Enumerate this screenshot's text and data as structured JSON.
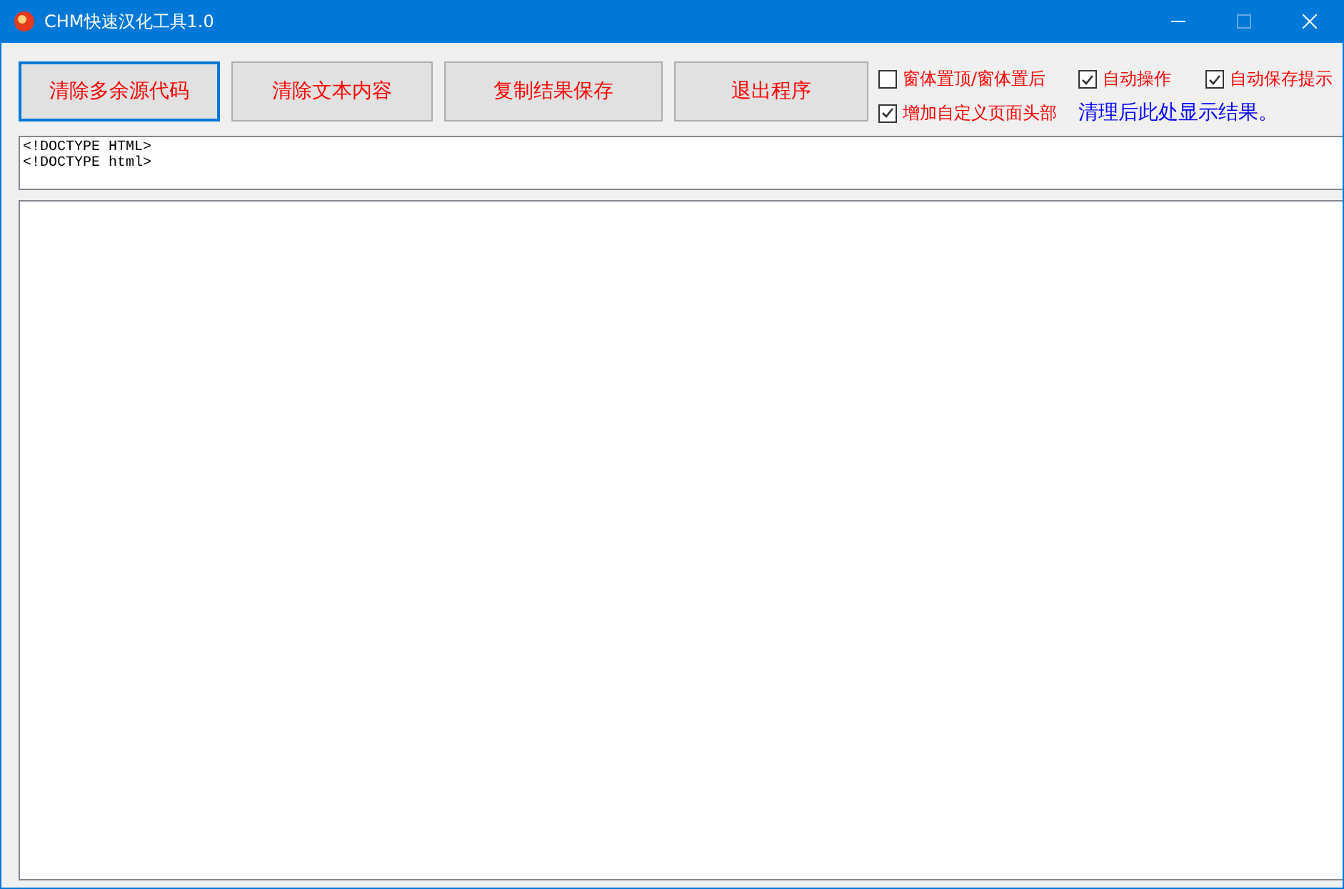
{
  "window": {
    "title": "CHM快速汉化工具1.0"
  },
  "buttons": [
    {
      "label": "清除多余源代码",
      "selected": true
    },
    {
      "label": "清除文本内容",
      "selected": false
    },
    {
      "label": "复制结果保存",
      "selected": false
    },
    {
      "label": "退出程序",
      "selected": false
    }
  ],
  "options": [
    {
      "label": "窗体置顶/窗体置后",
      "checked": false
    },
    {
      "label": "自动操作",
      "checked": true
    },
    {
      "label": "自动保存提示",
      "checked": true
    },
    {
      "label": "增加自定义页面头部",
      "checked": true
    }
  ],
  "status_text": "清理后此处显示结果。",
  "source_box": {
    "lines": [
      "<!DOCTYPE HTML>",
      "<!DOCTYPE html>"
    ]
  }
}
